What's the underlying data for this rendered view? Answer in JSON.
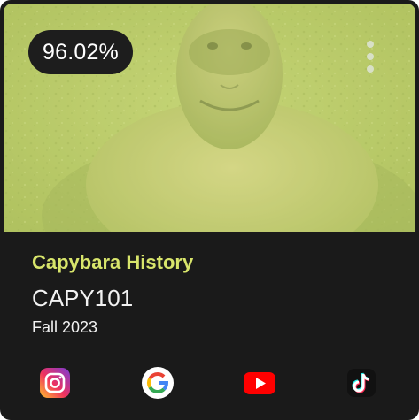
{
  "course_card": {
    "grade": "96.02%",
    "course_name": "Capybara History",
    "course_code": "CAPY101",
    "term": "Fall 2023",
    "image_subject": "capybara",
    "accent_color": "#d8e56b",
    "overlay_color": "#bfd16e"
  },
  "socials": [
    {
      "icon": "instagram-icon"
    },
    {
      "icon": "google-icon"
    },
    {
      "icon": "youtube-icon"
    },
    {
      "icon": "tiktok-icon"
    }
  ]
}
